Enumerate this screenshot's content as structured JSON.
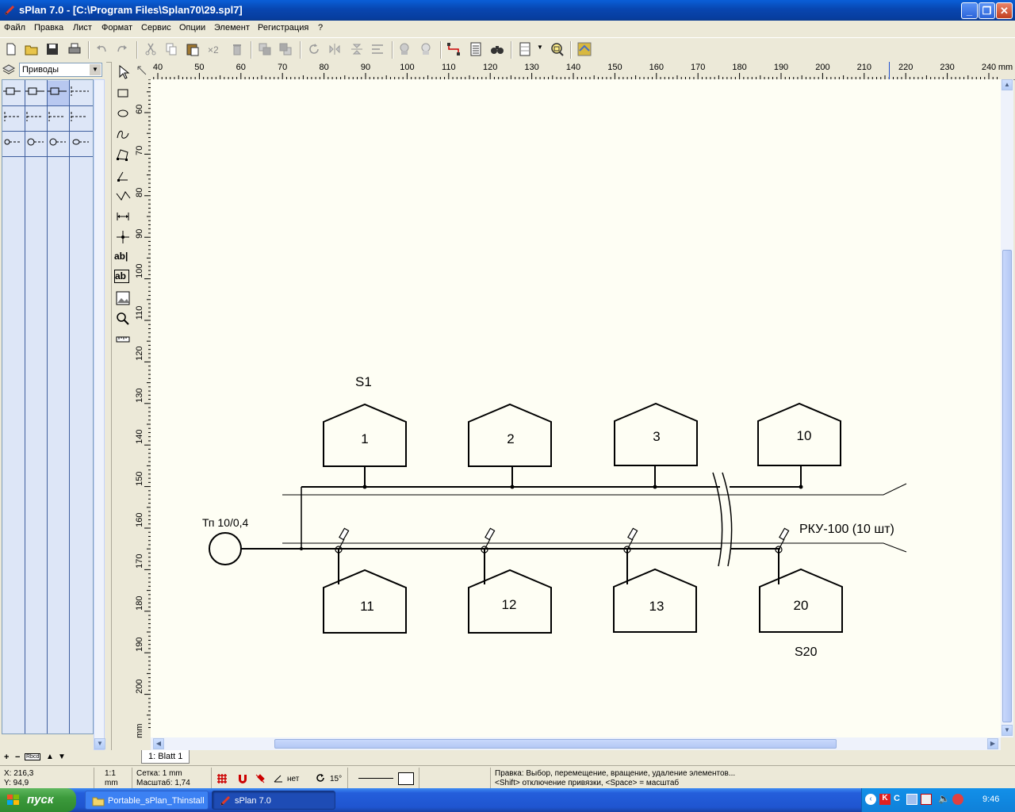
{
  "window": {
    "title": "sPlan 7.0 - [C:\\Program Files\\Splan70\\29.spl7]"
  },
  "menu": [
    "Файл",
    "Правка",
    "Лист",
    "Формат",
    "Сервис",
    "Опции",
    "Элемент",
    "Регистрация",
    "?"
  ],
  "toolbar": {
    "zoom_multiplier": "×2"
  },
  "library": {
    "selected": "Приводы",
    "label_strip": "Rbcd"
  },
  "ruler": {
    "h_ticks": [
      "40",
      "50",
      "60",
      "70",
      "80",
      "90",
      "100",
      "110",
      "120",
      "130",
      "140",
      "150",
      "160",
      "170",
      "180",
      "190",
      "200",
      "210",
      "220",
      "230",
      "240"
    ],
    "h_unit": "mm",
    "v_ticks": [
      "60",
      "70",
      "80",
      "90",
      "100",
      "110",
      "120",
      "130",
      "140",
      "150",
      "160",
      "170",
      "180",
      "190",
      "200"
    ],
    "v_unit": "mm"
  },
  "schematic": {
    "transformer_label": "Тп 10/0,4",
    "top_group_label": "S1",
    "bottom_group_label": "S20",
    "device_label": "РКУ-100 (10 шт)",
    "top_units": [
      "1",
      "2",
      "3",
      "10"
    ],
    "bottom_units": [
      "11",
      "12",
      "13",
      "20"
    ]
  },
  "sheet_tab": "1: Blatt 1",
  "status": {
    "coord_x": "X: 216,3",
    "coord_y": "Y: 94,9",
    "scale_ratio": "1:1",
    "scale_unit": "mm",
    "grid": "Сетка: 1 mm",
    "zoom": "Масштаб:   1,74",
    "angle_snap": "нет",
    "rotation": "15°",
    "hint_line1": "Правка: Выбор, перемещение, вращение, удаление элементов...",
    "hint_line2": "<Shift> отключение привязки, <Space> = масштаб"
  },
  "taskbar": {
    "start": "пуск",
    "tasks": [
      "Portable_sPlan_Thinstall",
      "sPlan 7.0"
    ],
    "clock": "9:46"
  }
}
